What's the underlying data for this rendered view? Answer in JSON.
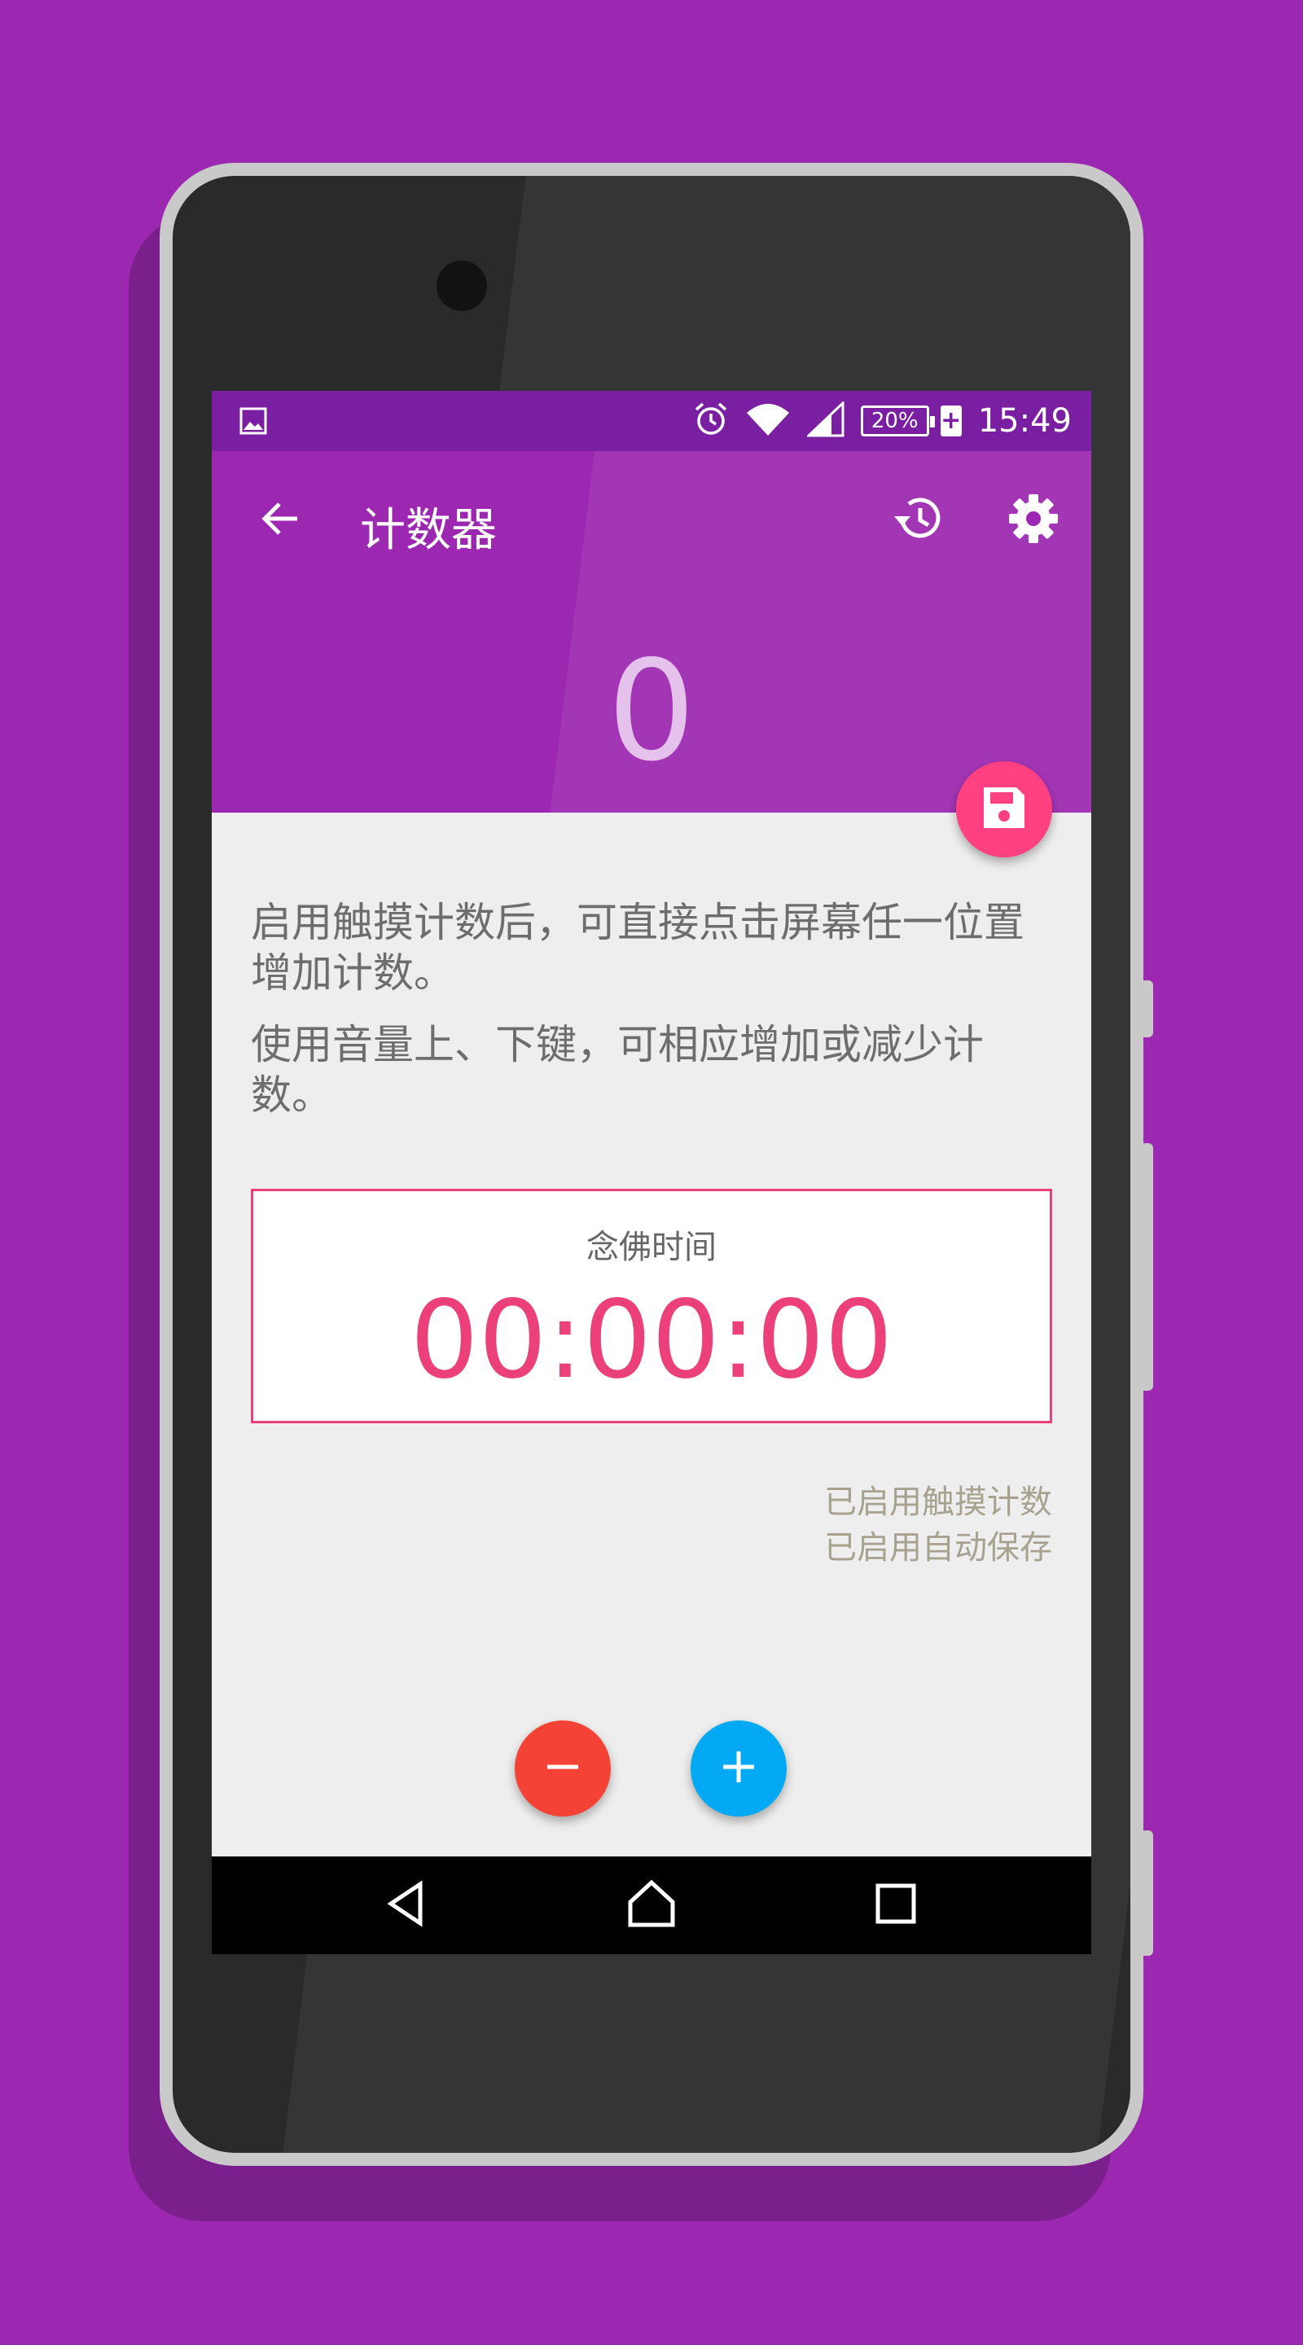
{
  "status_bar": {
    "time": "15:49",
    "battery": "20%",
    "charging_symbol": "+",
    "icons": [
      "image-notification-icon",
      "alarm-icon",
      "wifi-icon",
      "signal-icon",
      "battery-icon"
    ]
  },
  "toolbar": {
    "title": "计数器",
    "back_icon": "arrow-back-icon",
    "history_icon": "history-icon",
    "settings_icon": "gear-icon"
  },
  "counter": {
    "value": "0"
  },
  "save_fab": {
    "icon": "save-icon",
    "color": "#ff4081"
  },
  "hints": [
    "启用触摸计数后，可直接点击屏幕任一位置增加计数。",
    "使用音量上、下键，可相应增加或减少计数。"
  ],
  "timer": {
    "label": "念佛时间",
    "value": "00:00:00",
    "color": "#ec407a"
  },
  "status_notes": [
    "已启用触摸计数",
    "已启用自动保存"
  ],
  "controls": {
    "decrement": {
      "icon": "minus-icon",
      "color": "#f44336"
    },
    "increment": {
      "icon": "plus-icon",
      "color": "#03a9f4"
    }
  },
  "nav": {
    "back": "nav-back-icon",
    "home": "nav-home-icon",
    "recents": "nav-recents-icon"
  },
  "colors": {
    "primary": "#9c27b0",
    "primary_dark": "#7b1fa2",
    "accent": "#ff4081"
  }
}
